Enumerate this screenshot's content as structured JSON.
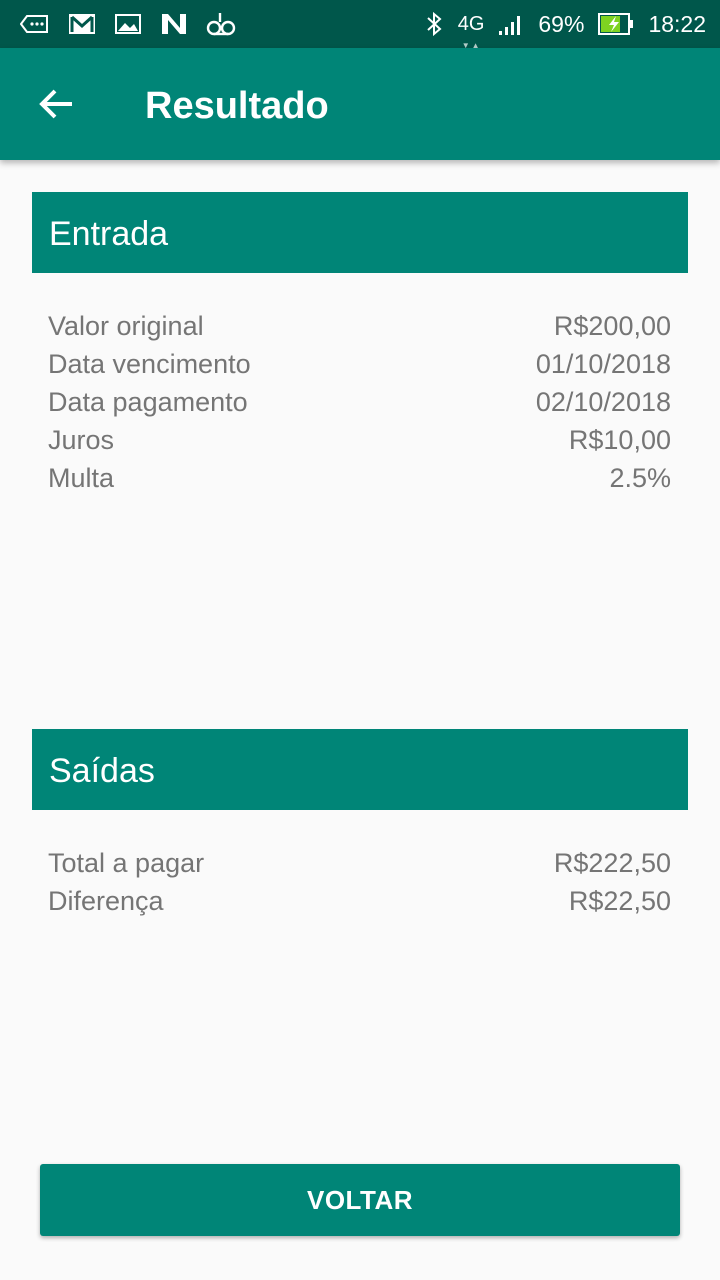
{
  "status_bar": {
    "network": "4G",
    "battery": "69%",
    "time": "18:22",
    "left_icons": [
      "voicemail-tape-icon",
      "gmail-icon",
      "image-icon",
      "n-app-icon",
      "voicemail-icon"
    ],
    "right_icons": [
      "bluetooth-icon",
      "signal-icon",
      "battery-charging-icon"
    ]
  },
  "app_bar": {
    "title": "Resultado",
    "back_icon": "arrow-back-icon"
  },
  "entrada": {
    "title": "Entrada",
    "rows": [
      {
        "label": "Valor original",
        "value": "R$200,00"
      },
      {
        "label": "Data vencimento",
        "value": "01/10/2018"
      },
      {
        "label": "Data pagamento",
        "value": "02/10/2018"
      },
      {
        "label": "Juros",
        "value": "R$10,00"
      },
      {
        "label": "Multa",
        "value": "2.5%"
      }
    ]
  },
  "saidas": {
    "title": "Saídas",
    "rows": [
      {
        "label": "Total a pagar",
        "value": "R$222,50"
      },
      {
        "label": "Diferença",
        "value": "R$22,50"
      }
    ]
  },
  "actions": {
    "back_label": "VOLTAR"
  },
  "colors": {
    "primary": "#008577",
    "primary_dark": "#00574b",
    "text_secondary": "#757575",
    "background": "#fafafa"
  }
}
